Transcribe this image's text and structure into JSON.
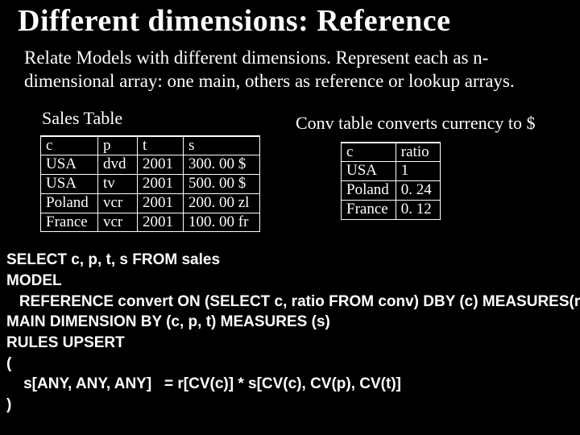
{
  "title": "Different dimensions:  Reference",
  "subtitle": "Relate Models with different dimensions. Represent each as n-dimensional array: one main, others as reference or lookup arrays.",
  "sales_caption": "Sales Table",
  "conv_caption": "Conv table converts currency to $",
  "sales": {
    "headers": {
      "c": "c",
      "p": "p",
      "t": "t",
      "s": "s"
    },
    "rows": [
      {
        "c": "USA",
        "p": "dvd",
        "t": "2001",
        "s": "300. 00 $"
      },
      {
        "c": "USA",
        "p": "tv",
        "t": "2001",
        "s": "500. 00 $"
      },
      {
        "c": "Poland",
        "p": "vcr",
        "t": "2001",
        "s": "200. 00 zl"
      },
      {
        "c": "France",
        "p": "vcr",
        "t": "2001",
        "s": "100. 00 fr"
      }
    ]
  },
  "conv": {
    "headers": {
      "c": "c",
      "ratio": "ratio"
    },
    "rows": [
      {
        "c": "USA",
        "ratio": "1"
      },
      {
        "c": "Poland",
        "ratio": "0. 24"
      },
      {
        "c": "France",
        "ratio": "0. 12"
      }
    ]
  },
  "sql": {
    "l1": "SELECT c, p, t, s FROM sales",
    "l2": "MODEL",
    "l3": "   REFERENCE convert ON (SELECT c, ratio FROM conv) DBY (c) MEASURES(r)",
    "l4": "MAIN DIMENSION BY (c, p, t) MEASURES (s)",
    "l5": "RULES UPSERT",
    "l6": "(",
    "l7": "    s[ANY, ANY, ANY]   = r[CV(c)] * s[CV(c), CV(p), CV(t)]",
    "l8": ")"
  }
}
